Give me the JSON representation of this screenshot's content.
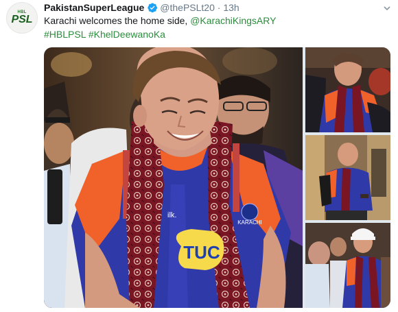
{
  "account": {
    "avatar": {
      "top_text": "HBL",
      "main_text": "PSL"
    },
    "display_name": "PakistanSuperLeague",
    "verified_icon": "verified-badge-icon",
    "handle": "@thePSLt20",
    "separator": "·",
    "time_ago": "13h"
  },
  "tweet": {
    "text_plain": "Karachi welcomes the home side, ",
    "mention": "@KarachiKingsARY",
    "hashtag_1": "#HBLPSL",
    "hashtag_2": "#KhelDeewanoKa"
  },
  "media": {
    "photos": [
      "main-photo",
      "top-right-photo",
      "middle-right-photo",
      "bottom-right-photo"
    ],
    "jersey_sponsor": "TUC",
    "jersey_brand": "ilk.",
    "jersey_crest": "KARACHI"
  },
  "colors": {
    "brand_green": "#2a8c3c",
    "verified_blue": "#1da1f2",
    "jersey_blue": "#2f3aa8",
    "jersey_orange": "#f0622a",
    "ajrak_maroon": "#7a1524"
  },
  "icons": {
    "caret": "chevron-down-icon"
  }
}
